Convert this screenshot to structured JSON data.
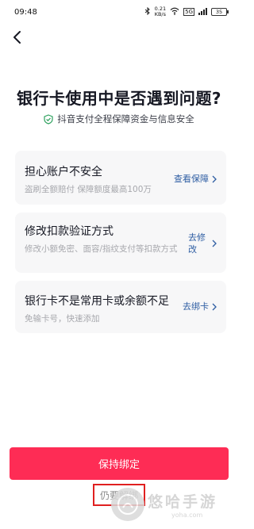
{
  "status_bar": {
    "time": "09:48",
    "speed_value": "0.21",
    "speed_unit": "KB/s",
    "network": "5G",
    "battery": "35"
  },
  "page": {
    "title": "银行卡使用中是否遇到问题?",
    "subtitle": "抖音支付全程保障资金与信息安全"
  },
  "cards": [
    {
      "title": "担心账户不安全",
      "desc": "盗刷全额赔付 保障额度最高100万",
      "action": "查看保障"
    },
    {
      "title": "修改扣款验证方式",
      "desc": "修改小额免密、面容/指纹支付等扣款方式",
      "action": "去修改"
    },
    {
      "title": "银行卡不是常用卡或余额不足",
      "desc": "免输卡号，快速添加",
      "action": "去绑卡"
    }
  ],
  "footer": {
    "primary_button": "保持绑定",
    "secondary_link": "仍要解绑"
  },
  "watermark": {
    "text": "悠哈手游",
    "url": "yoha.com"
  },
  "colors": {
    "primary": "#fe2c55",
    "link": "#2f5ea3",
    "card_bg": "#f7f7f8",
    "shield": "#2ea15e"
  }
}
